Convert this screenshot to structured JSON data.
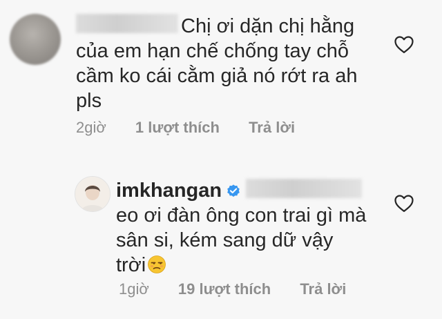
{
  "comments": [
    {
      "text_lines": [
        "Chị ơi dặn chị hằng",
        "của em hạn chế chống tay chỗ",
        "cầm ko cái cằm giả nó rớt ra ah",
        "pls"
      ],
      "time": "2giờ",
      "likes": "1 lượt thích",
      "reply": "Trả lời"
    },
    {
      "username": "imkhangan",
      "text_lines": [
        "eo ơi đàn ông con trai gì mà",
        "sân si, kém sang dữ vậy",
        "trời"
      ],
      "emoji": "unamused-face",
      "time": "1giờ",
      "likes": "19 lượt thích",
      "reply": "Trả lời"
    }
  ],
  "icons": {
    "like": "heart-outline-icon",
    "verified": "verified-badge-icon"
  },
  "colors": {
    "text": "#262626",
    "meta": "#8e8e8e",
    "verified": "#3897f0",
    "background": "#f7f7f7"
  }
}
